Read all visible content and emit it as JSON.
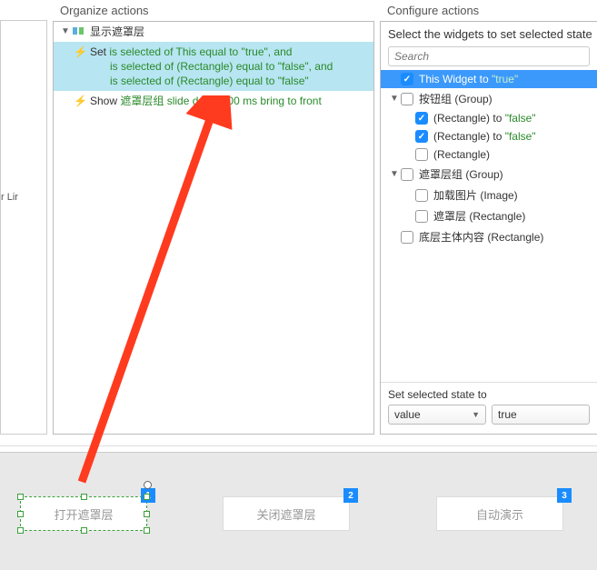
{
  "left_sliver_text": "r Lir",
  "organize": {
    "title": "Organize actions",
    "case_label": "显示遮罩层",
    "action1_prefix": "Set ",
    "action1_line1a": "is selected of This equal to \"true\", and",
    "action1_line2": "is selected of (Rectangle) equal to \"false\", and",
    "action1_line3": "is selected of (Rectangle) equal to \"false\"",
    "action2_prefix": "Show ",
    "action2_mid": "遮罩层组 slide down 500 ms bring to front"
  },
  "configure": {
    "title": "Configure actions",
    "header": "Select the widgets to set selected state",
    "search_placeholder": "Search",
    "row_this_widget": "This Widget to ",
    "row_this_widget_val": "\"true\"",
    "row_btn_group": "按钮组 (Group)",
    "row_rect_false": "(Rectangle) to ",
    "row_rect_false_val": "\"false\"",
    "row_rect": "(Rectangle)",
    "row_mask_group": "遮罩层组 (Group)",
    "row_load_img": "加载图片 (Image)",
    "row_mask_rect": "遮罩层 (Rectangle)",
    "row_bottom": "底层主体内容 (Rectangle)"
  },
  "state": {
    "label": "Set selected state to",
    "dropdown1": "value",
    "dropdown2": "true"
  },
  "tabs": {
    "t1": "打开遮罩层",
    "t2": "关闭遮罩层",
    "t3": "自动演示",
    "b1": "1",
    "b2": "2",
    "b3": "3"
  }
}
